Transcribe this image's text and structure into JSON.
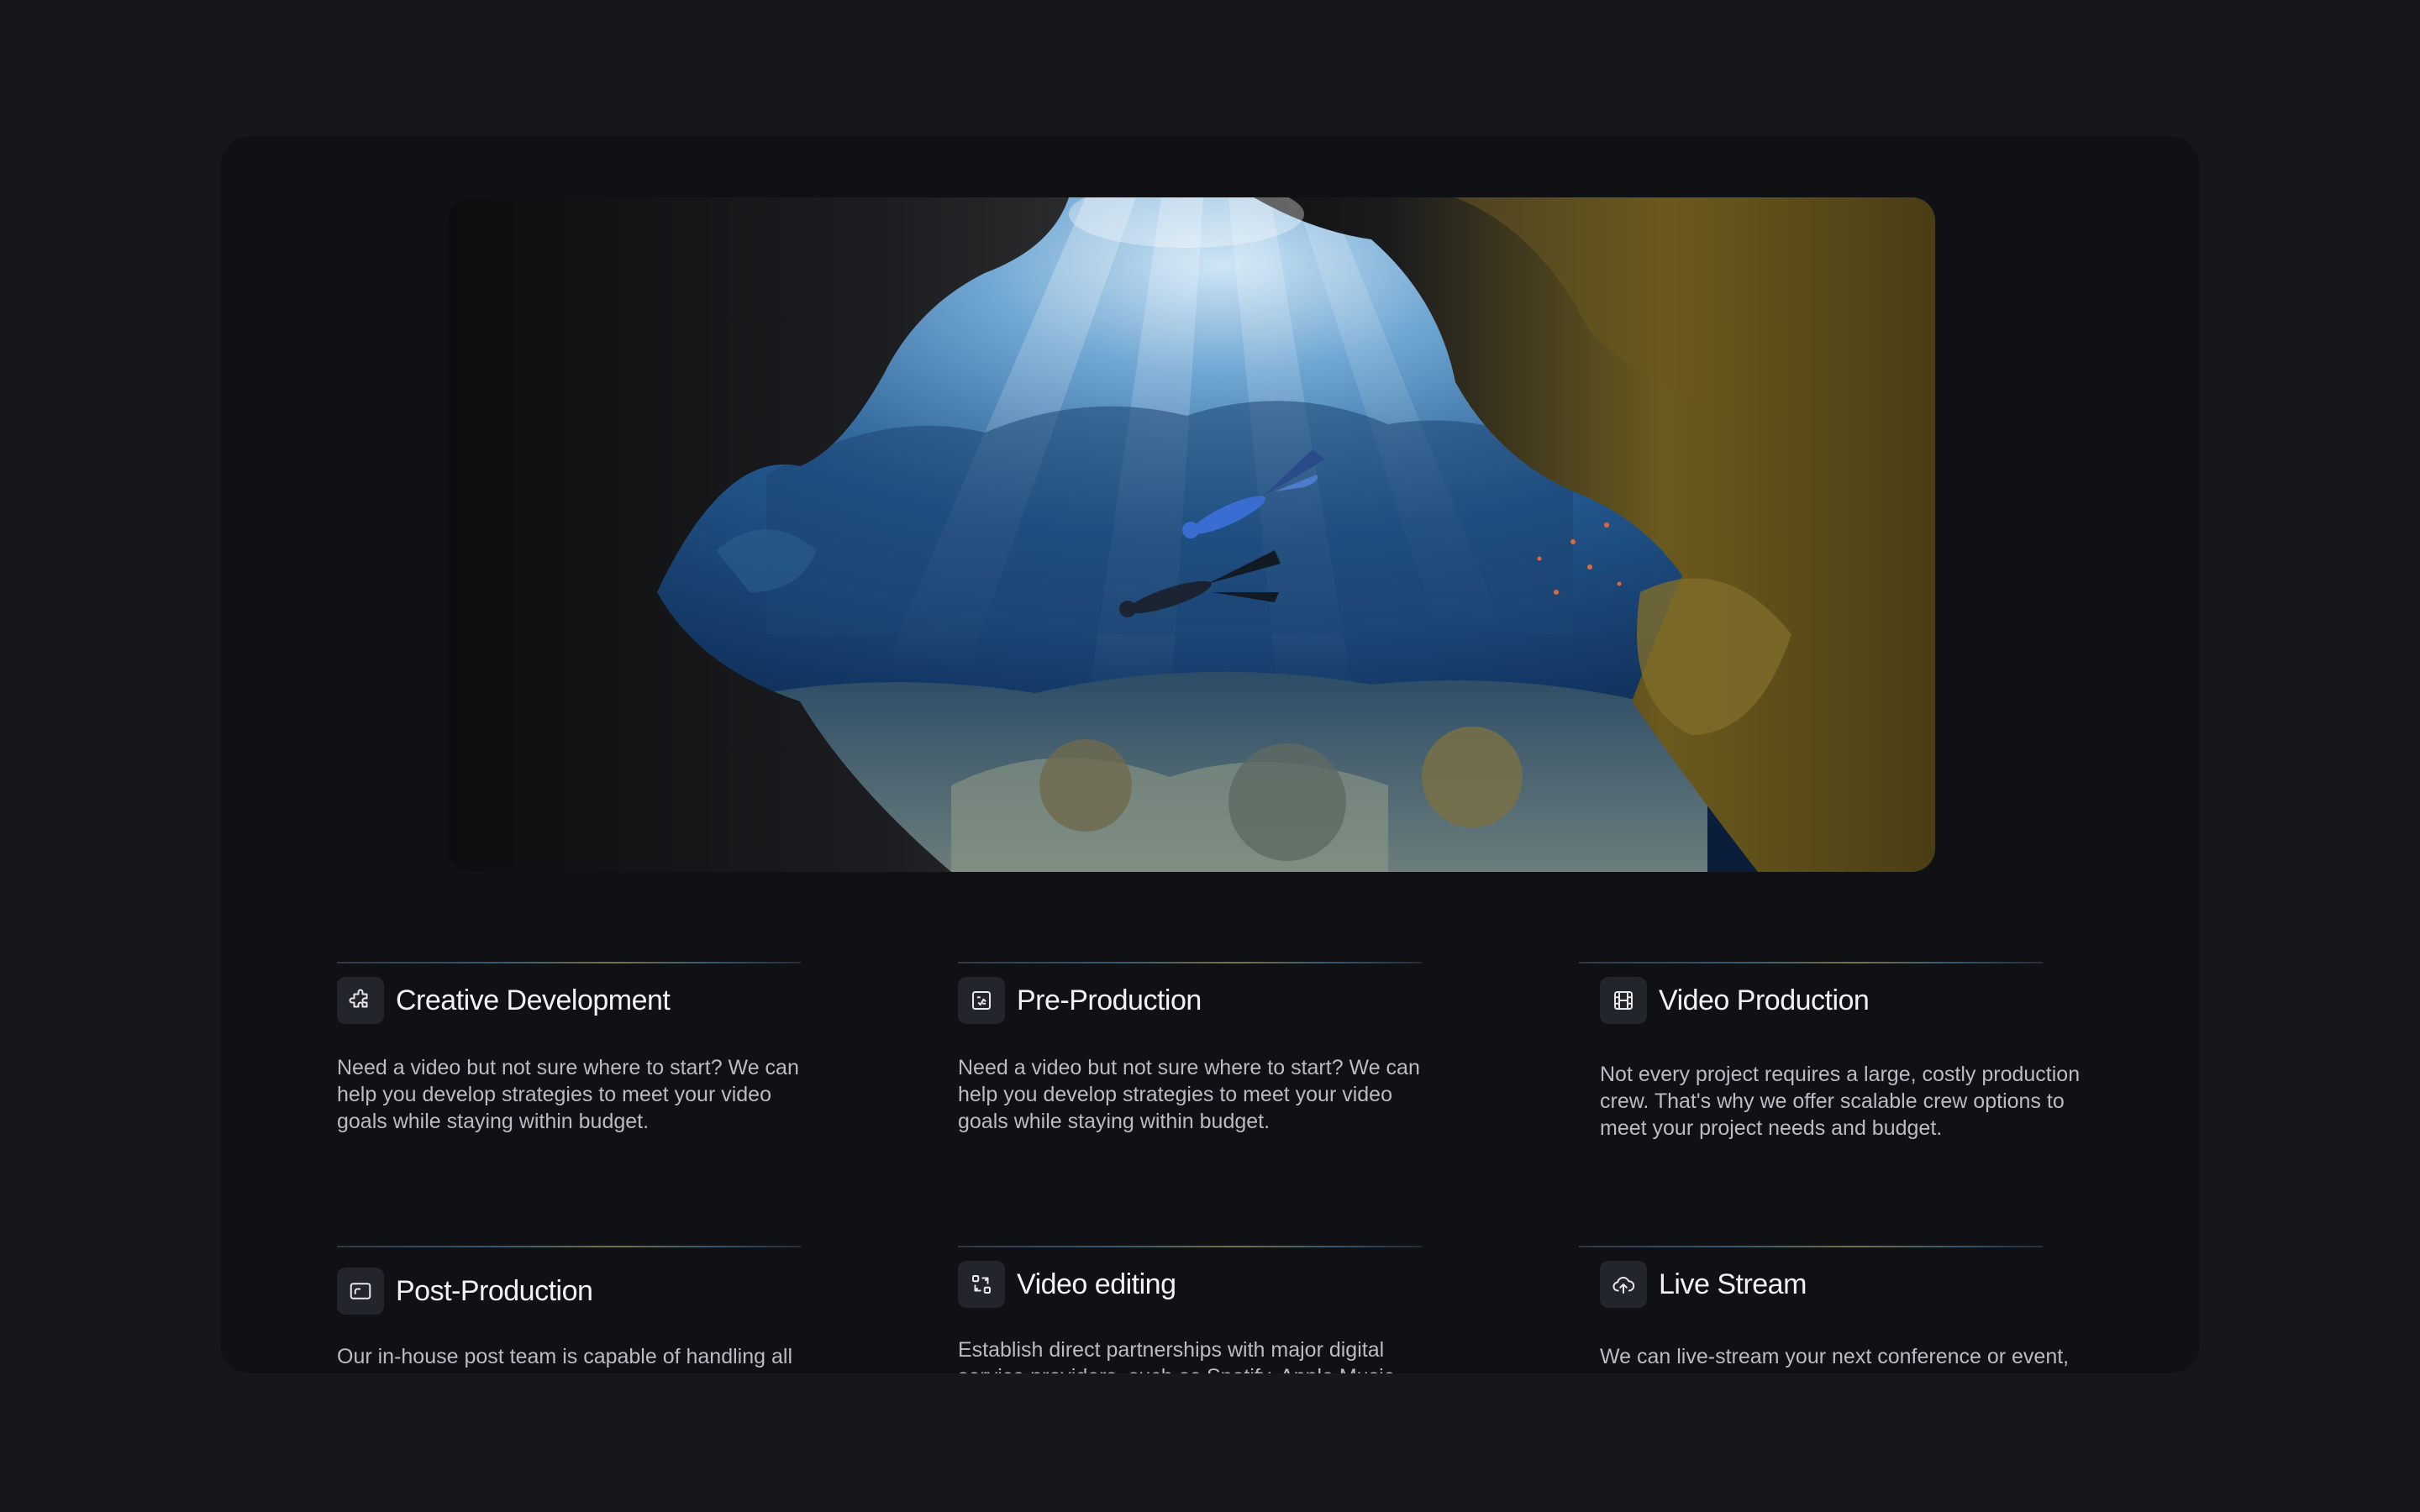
{
  "services": [
    {
      "title": "Creative Development",
      "icon": "puzzle-icon",
      "description": "Need a video but not sure where to start? We can help you develop strategies to meet your video goals while staying within budget."
    },
    {
      "title": "Pre-Production",
      "icon": "storyboard-icon",
      "description": "Need a video but not sure where to start? We can help you develop strategies to meet your video goals while staying within budget."
    },
    {
      "title": "Video Production",
      "icon": "film-icon",
      "description": "Not every project requires a large, costly production crew. That's why we offer scalable crew options to meet your project needs and budget."
    },
    {
      "title": "Post-Production",
      "icon": "screen-icon",
      "description": "Our in-house post team is capable of handling all"
    },
    {
      "title": "Video editing",
      "icon": "swap-icon",
      "description": "Establish direct partnerships with major digital service providers, such as Spotify, Apple Music"
    },
    {
      "title": "Live Stream",
      "icon": "cloud-upload-icon",
      "description": "We can live-stream your next conference or event,"
    }
  ],
  "colors": {
    "page_background": "#15171b",
    "panel_background": "#101114",
    "title": "#f1f2f4",
    "description": "#b8bcc4"
  }
}
